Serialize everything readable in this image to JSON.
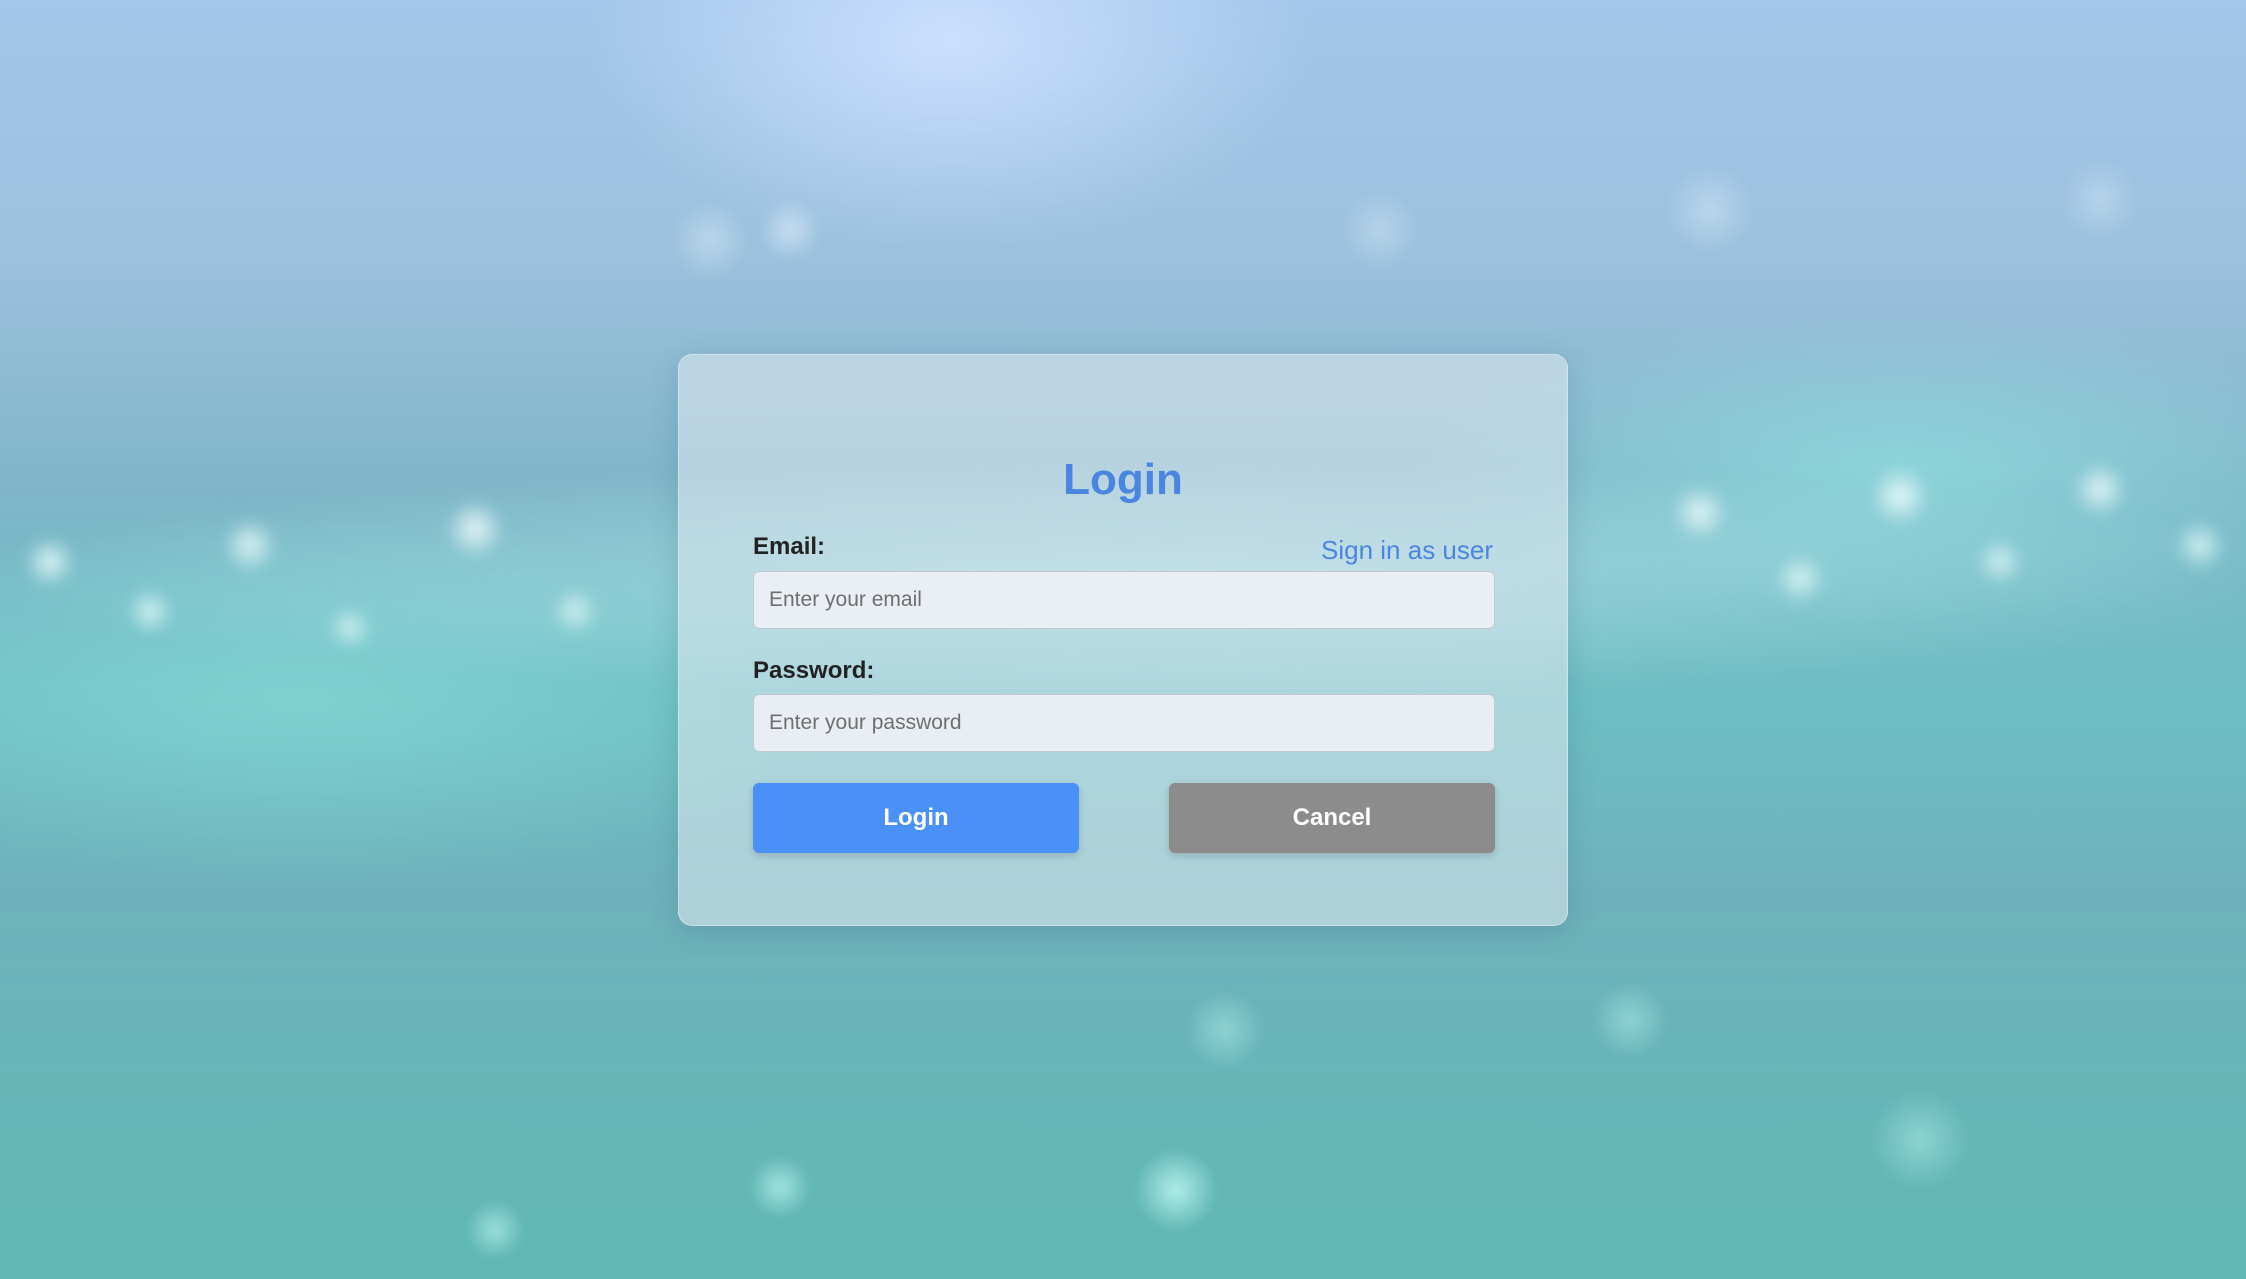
{
  "login": {
    "title": "Login",
    "signin_link": "Sign in as user",
    "email": {
      "label": "Email:",
      "value": "",
      "placeholder": "Enter your email"
    },
    "password": {
      "label": "Password:",
      "value": "",
      "placeholder": "Enter your password"
    },
    "buttons": {
      "login": "Login",
      "cancel": "Cancel"
    }
  },
  "colors": {
    "accent": "#4a86e0",
    "login_button": "#4a90f6",
    "cancel_button": "#8c8c8c"
  }
}
